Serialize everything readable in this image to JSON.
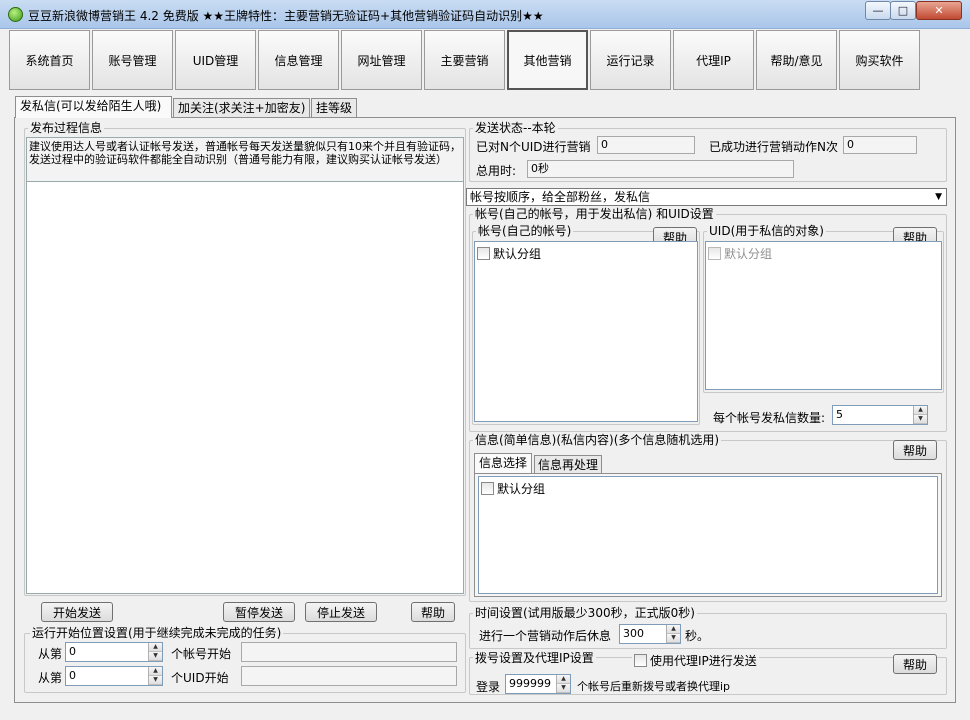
{
  "window": {
    "title": "豆豆新浪微博营销王 4.2 免费版   ★★王牌特性：主要营销无验证码+其他营销验证码自动识别★★",
    "min_glyph": "—",
    "max_glyph": "□",
    "close_glyph": "✕"
  },
  "nav": [
    "系统首页",
    "账号管理",
    "UID管理",
    "信息管理",
    "网址管理",
    "主要营销",
    "其他营销",
    "运行记录",
    "代理IP",
    "帮助/意见",
    "购买软件"
  ],
  "tabs": [
    "发私信(可以发给陌生人哦)",
    "加关注(求关注+加密友)",
    "挂等级"
  ],
  "left": {
    "log_title": "发布过程信息",
    "log_text": "建议使用达人号或者认证帐号发送，普通帐号每天发送量貌似只有10来个并且有验证码，发送过程中的验证码软件都能全自动识别（普通号能力有限，建议购买认证帐号发送）",
    "start_button": "开始发送",
    "pause_button": "暂停发送",
    "stop_button": "停止发送",
    "help_button": "帮助",
    "position_title": "运行开始位置设置(用于继续完成未完成的任务)",
    "from_label": "从第",
    "account_from_value": "0",
    "account_suffix": "个帐号开始",
    "uid_from_value": "0",
    "uid_suffix": "个UID开始"
  },
  "status": {
    "title": "发送状态--本轮",
    "uid_count_label": "已对N个UID进行营销",
    "uid_count_value": "0",
    "success_label": "已成功进行营销动作N次",
    "success_value": "0",
    "total_time_label": "总用时:",
    "total_time_value": "0秒"
  },
  "mode_select": "帐号按顺序，给全部粉丝，发私信",
  "accounts": {
    "title": "帐号(自己的帐号，用于发出私信) 和UID设置",
    "own_title": "帐号(自己的帐号)",
    "own_help": "帮助",
    "own_group": "默认分组",
    "uid_title": "UID(用于私信的对象)",
    "uid_help": "帮助",
    "uid_group": "默认分组",
    "per_account_label": "每个帐号发私信数量:",
    "per_account_value": "5"
  },
  "info": {
    "title": "信息(简单信息)(私信内容)(多个信息随机选用)",
    "help": "帮助",
    "tabs": [
      "信息选择",
      "信息再处理"
    ],
    "group": "默认分组"
  },
  "timing": {
    "title": "时间设置(试用版最少300秒，正式版0秒)",
    "label": "进行一个营销动作后休息",
    "value": "300",
    "unit": "秒。"
  },
  "dial": {
    "title": "拨号设置及代理IP设置",
    "proxy_label": "使用代理IP进行发送",
    "help": "帮助",
    "login_label": "登录",
    "login_value": "999999",
    "login_suffix": "个帐号后重新拨号或者换代理ip"
  }
}
